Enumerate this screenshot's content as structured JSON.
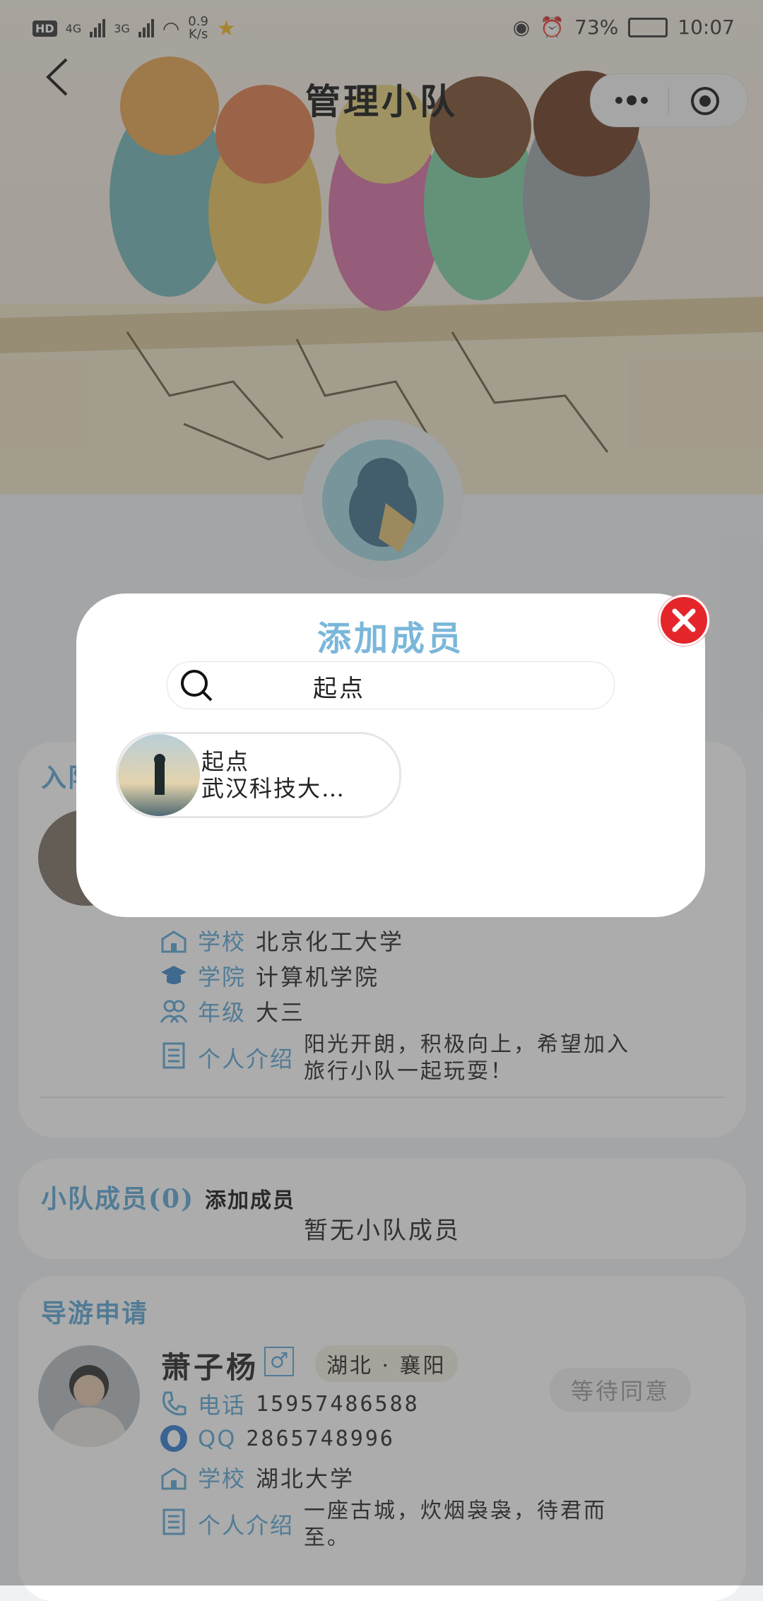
{
  "status_bar": {
    "left": {
      "hd": "HD",
      "net1": "4G",
      "net2": "3G",
      "speed_value": "0.9",
      "speed_unit": "K/s"
    },
    "battery": "73%",
    "time": "10:07"
  },
  "header": {
    "title": "管理小队"
  },
  "applicant": {
    "section_title": "入队申请",
    "school_label": "学校",
    "school": "北京化工大学",
    "college_label": "学院",
    "college": "计算机学院",
    "grade_label": "年级",
    "grade": "大三",
    "intro_label": "个人介绍",
    "intro": "阳光开朗，积极向上，希望加入旅行小队一起玩耍！"
  },
  "members": {
    "title": "小队成员(0)",
    "add_label": "添加成员",
    "empty_text": "暂无小队成员"
  },
  "guide": {
    "section_title": "导游申请",
    "name": "萧子杨",
    "gender": "♂",
    "location": "湖北 · 襄阳",
    "status": "等待同意",
    "phone_label": "电话",
    "phone": "15957486588",
    "qq_label": "QQ",
    "qq": "2865748996",
    "school_label": "学校",
    "school": "湖北大学",
    "intro_label": "个人介绍",
    "intro": "一座古城，炊烟袅袅，待君而至。"
  },
  "modal": {
    "title": "添加成员",
    "search_value": "起点",
    "result": {
      "name": "起点",
      "school": "武汉科技大…"
    }
  },
  "colors": {
    "accent": "#5aa7d6",
    "close": "#e4262b"
  }
}
